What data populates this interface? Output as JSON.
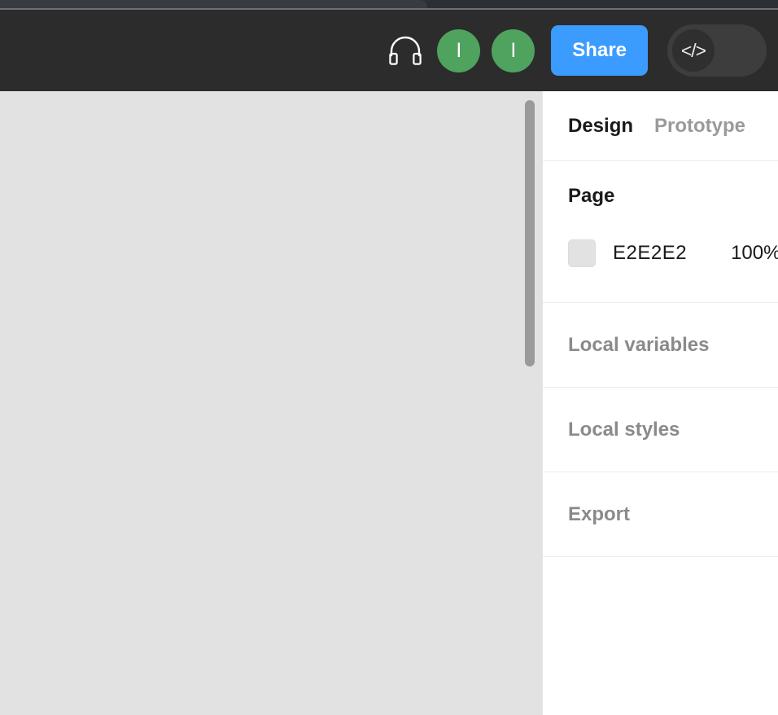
{
  "toolbar": {
    "headphones_icon": "headphones-icon",
    "avatars": [
      {
        "initial": "I",
        "color": "#4fa35f"
      },
      {
        "initial": "I",
        "color": "#4fa35f"
      }
    ],
    "share_label": "Share",
    "dev_mode_toggle": {
      "icon_label": "</>",
      "state": "off"
    }
  },
  "canvas": {
    "background_color": "#E2E2E2"
  },
  "panel": {
    "tabs": [
      {
        "label": "Design",
        "active": true
      },
      {
        "label": "Prototype",
        "active": false
      }
    ],
    "page": {
      "title": "Page",
      "color_hex": "E2E2E2",
      "opacity": "100%"
    },
    "sections": [
      {
        "label": "Local variables"
      },
      {
        "label": "Local styles"
      },
      {
        "label": "Export"
      }
    ]
  }
}
